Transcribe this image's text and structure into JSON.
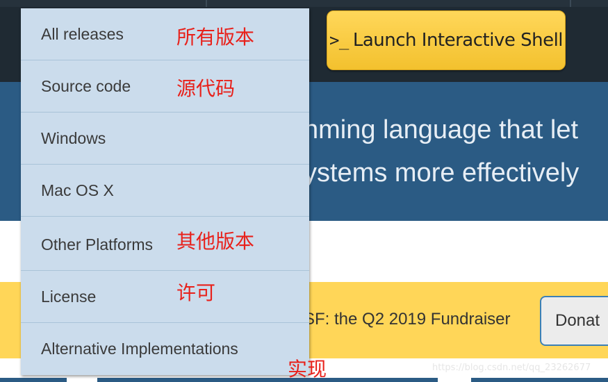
{
  "header": {
    "shell_button": {
      "prompt_icon": ">_",
      "label": "Launch Interactive Shell"
    }
  },
  "hero": {
    "line1": "nming language that let",
    "line2": "ystems more effectively"
  },
  "banner": {
    "text": "SF: the Q2 2019 Fundraiser",
    "donate_label": "Donat"
  },
  "dropdown": {
    "items": [
      {
        "label": "All releases"
      },
      {
        "label": "Source code"
      },
      {
        "label": "Windows"
      },
      {
        "label": "Mac OS X"
      },
      {
        "label": "Other Platforms"
      },
      {
        "label": "License"
      },
      {
        "label": "Alternative Implementations"
      }
    ]
  },
  "annotations": {
    "all_releases": "所有版本",
    "source_code": "源代码",
    "other_platforms": "其他版本",
    "license": "许可",
    "alternative": "实现"
  },
  "watermark": "https://blog.csdn.net/qq_23262677",
  "colors": {
    "topbar": "#1f2a33",
    "hero": "#2b5b84",
    "accent_yellow": "#ffd658",
    "dropdown_bg": "#cbdcec",
    "annotation_red": "#e8211b"
  }
}
